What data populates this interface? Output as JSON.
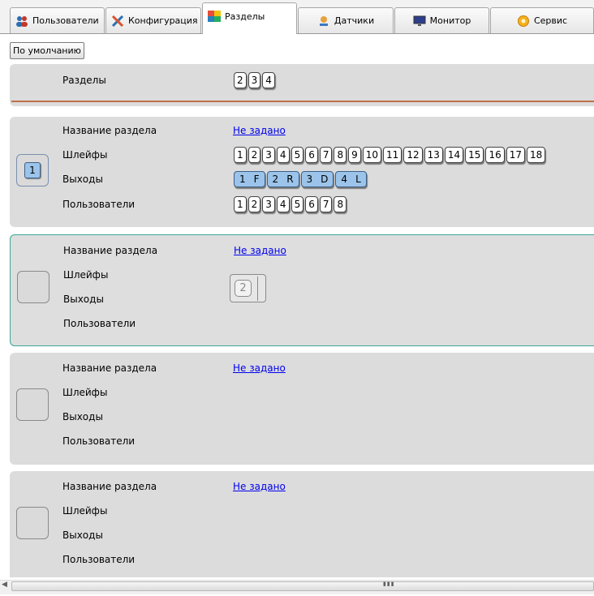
{
  "tabs": [
    {
      "label": "Пользователи",
      "icon": "users-icon"
    },
    {
      "label": "Конфигурация",
      "icon": "tools-icon"
    },
    {
      "label": "Разделы",
      "icon": "partitions-icon"
    },
    {
      "label": "Датчики",
      "icon": "sensor-icon"
    },
    {
      "label": "Монитор",
      "icon": "monitor-icon"
    },
    {
      "label": "Сервис",
      "icon": "service-icon"
    }
  ],
  "active_tab": "Разделы",
  "toolbar": {
    "default_label": "По умолчанию"
  },
  "partitions_row": {
    "label": "Разделы",
    "chips": [
      "2",
      "3",
      "4"
    ]
  },
  "field_labels": {
    "name": "Название раздела",
    "loops": "Шлейфы",
    "outputs": "Выходы",
    "users": "Пользователи",
    "not_set": "Не задано"
  },
  "partition1": {
    "number": "1",
    "loops": [
      "1",
      "2",
      "3",
      "4",
      "5",
      "6",
      "7",
      "8",
      "9",
      "10",
      "11",
      "12",
      "13",
      "14",
      "15",
      "16",
      "17",
      "18"
    ],
    "outputs": [
      {
        "n": "1",
        "letter": "F"
      },
      {
        "n": "2",
        "letter": "R"
      },
      {
        "n": "3",
        "letter": "D"
      },
      {
        "n": "4",
        "letter": "L"
      }
    ],
    "users": [
      "1",
      "2",
      "3",
      "4",
      "5",
      "6",
      "7",
      "8"
    ]
  },
  "dragged_chip": "2",
  "colors": {
    "accent_blue": "#9cc4ea",
    "selection_border": "#3aa89a",
    "link": "#0000ee",
    "separator": "#c0704a"
  }
}
